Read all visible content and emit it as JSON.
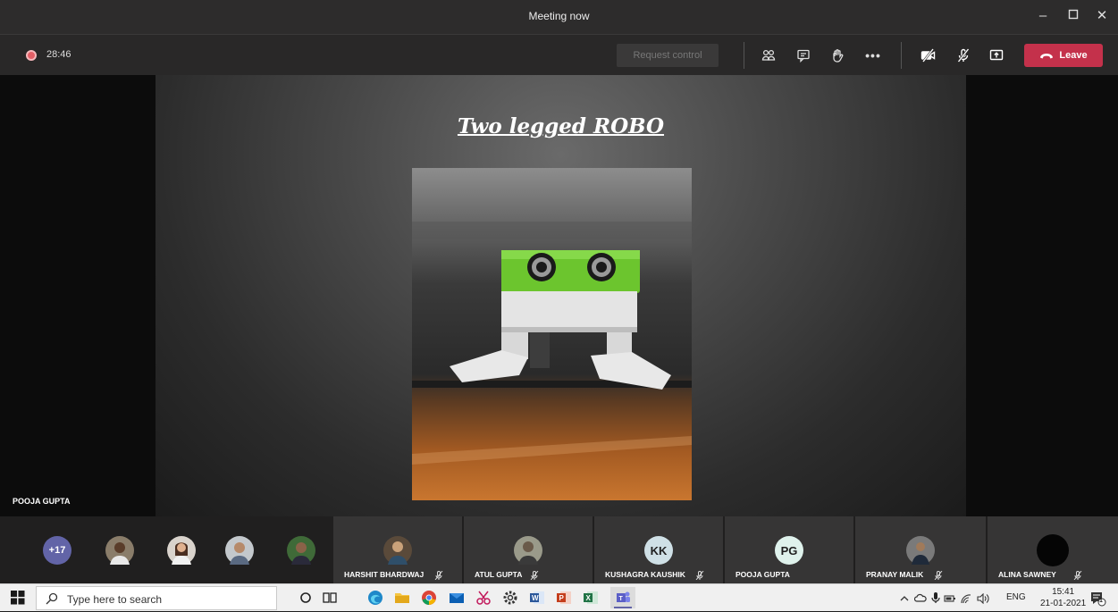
{
  "window": {
    "title": "Meeting now"
  },
  "toolbar": {
    "timer": "28:46",
    "request_control": "Request control",
    "leave_label": "Leave"
  },
  "slide": {
    "title": "Two legged ROBO",
    "presenter": "POOJA GUPTA"
  },
  "participants": {
    "overflow_count": "+17",
    "tiles": [
      {
        "name": "HARSHIT BHARDWAJ",
        "muted": true
      },
      {
        "name": "ATUL GUPTA",
        "muted": true
      },
      {
        "name": "KUSHAGRA KAUSHIK",
        "initials": "KK",
        "muted": true
      },
      {
        "name": "POOJA GUPTA",
        "initials": "PG",
        "muted": false
      },
      {
        "name": "PRANAY MALIK",
        "muted": true
      },
      {
        "name": "ALINA SAWNEY",
        "muted": true
      }
    ]
  },
  "taskbar": {
    "search_placeholder": "Type here to search",
    "language": "ENG",
    "time": "15:41",
    "date": "21-01-2021",
    "notification_count": "1"
  },
  "colors": {
    "leave": "#c4314b",
    "teams_accent": "#6264a7",
    "record": "#e35f66"
  }
}
